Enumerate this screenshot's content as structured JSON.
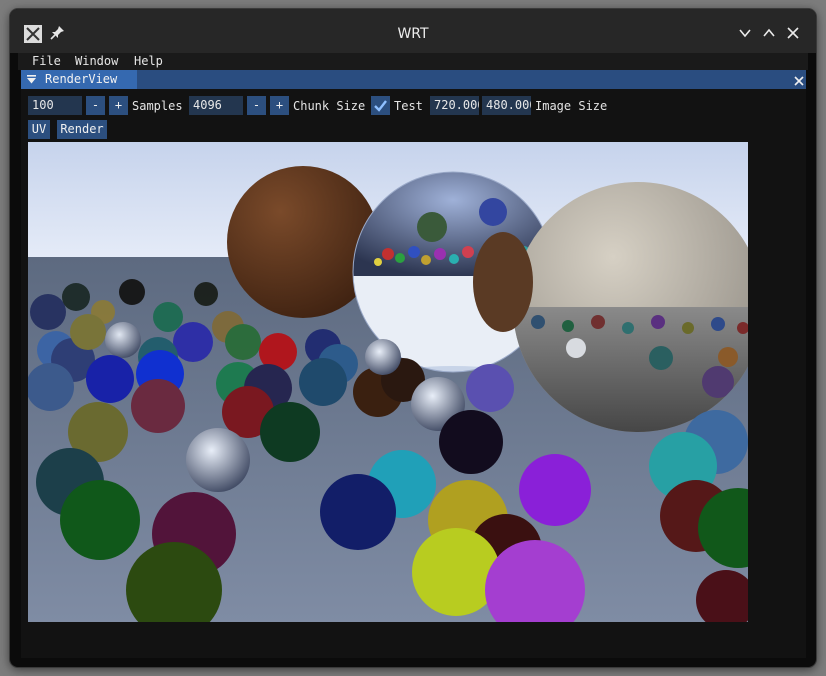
{
  "window": {
    "title": "WRT"
  },
  "menu": [
    "File",
    "Window",
    "Help"
  ],
  "panel": {
    "tab_label": "RenderView"
  },
  "toolbar": {
    "samples_value": "100",
    "minus_label": "-",
    "plus_label": "+",
    "samples_label": "Samples",
    "chunk_value": "4096",
    "chunk_label": "Chunk Size",
    "test_label": "Test",
    "test_checked": true,
    "width_value": "720.000",
    "height_value": "480.000",
    "image_size_label": "Image Size",
    "uv_label": "UV",
    "render_label": "Render"
  },
  "colors": {
    "titlebar": "#272727",
    "panel_tab_active": "#3569b0",
    "panel_tab_bar": "#2a4d80",
    "widget_bg": "#23364f",
    "button_bg": "#2c4f7f"
  },
  "icons": [
    "app-icon",
    "pin-icon",
    "minimize-icon",
    "maximize-icon",
    "close-icon",
    "collapse-arrow-icon",
    "checkmark-icon"
  ]
}
